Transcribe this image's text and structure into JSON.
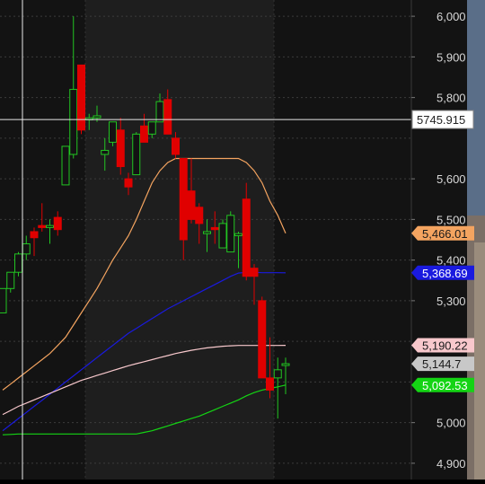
{
  "chart_data": {
    "type": "candlestick",
    "y_axis": {
      "ticks": [
        "6,000",
        "5,900",
        "5,800",
        "5,600",
        "5,500",
        "5,400",
        "5,300",
        "5,000",
        "4,900"
      ],
      "tick_values": [
        6000,
        5900,
        5800,
        5600,
        5500,
        5400,
        5300,
        5000,
        4900
      ],
      "ylim": [
        4860,
        6040
      ],
      "position": "right",
      "grid": true
    },
    "crosshair": {
      "price": 5745.915,
      "label": "5745.915"
    },
    "price_tags": [
      {
        "label": "5,466.01",
        "value": 5466.01,
        "color": "#f4a460"
      },
      {
        "label": "5,368.69",
        "value": 5368.69,
        "color": "#1a1adf"
      },
      {
        "label": "5,190.22",
        "value": 5190.22,
        "color": "#f8c8cc"
      },
      {
        "label": "5,144.7",
        "value": 5144.7,
        "color": "#c8c8c8"
      },
      {
        "label": "5,092.53",
        "value": 5092.53,
        "color": "#14d414"
      }
    ],
    "colors": {
      "up": "#22c522",
      "down": "#e00000",
      "background": "#131313",
      "shaded_band": "#1e1e1e"
    },
    "candles": [
      {
        "o": 5270,
        "h": 5330,
        "l": 5270,
        "c": 5330
      },
      {
        "o": 5330,
        "h": 5370,
        "l": 5320,
        "c": 5370
      },
      {
        "o": 5370,
        "h": 5420,
        "l": 5360,
        "c": 5415
      },
      {
        "o": 5415,
        "h": 5460,
        "l": 5400,
        "c": 5440
      },
      {
        "o": 5470,
        "h": 5480,
        "l": 5410,
        "c": 5455
      },
      {
        "o": 5485,
        "h": 5540,
        "l": 5470,
        "c": 5480
      },
      {
        "o": 5480,
        "h": 5500,
        "l": 5440,
        "c": 5485
      },
      {
        "o": 5505,
        "h": 5520,
        "l": 5460,
        "c": 5475
      },
      {
        "o": 5585,
        "h": 5680,
        "l": 5585,
        "c": 5680
      },
      {
        "o": 5660,
        "h": 6000,
        "l": 5650,
        "c": 5820
      },
      {
        "o": 5880,
        "h": 5880,
        "l": 5710,
        "c": 5720
      },
      {
        "o": 5745,
        "h": 5760,
        "l": 5720,
        "c": 5750
      },
      {
        "o": 5750,
        "h": 5780,
        "l": 5740,
        "c": 5755
      },
      {
        "o": 5660,
        "h": 5700,
        "l": 5620,
        "c": 5670
      },
      {
        "o": 5690,
        "h": 5740,
        "l": 5680,
        "c": 5740
      },
      {
        "o": 5720,
        "h": 5750,
        "l": 5610,
        "c": 5630
      },
      {
        "o": 5600,
        "h": 5615,
        "l": 5560,
        "c": 5580
      },
      {
        "o": 5610,
        "h": 5715,
        "l": 5610,
        "c": 5710
      },
      {
        "o": 5730,
        "h": 5760,
        "l": 5700,
        "c": 5690
      },
      {
        "o": 5710,
        "h": 5740,
        "l": 5700,
        "c": 5740
      },
      {
        "o": 5740,
        "h": 5810,
        "l": 5740,
        "c": 5790
      },
      {
        "o": 5795,
        "h": 5820,
        "l": 5710,
        "c": 5710
      },
      {
        "o": 5700,
        "h": 5715,
        "l": 5650,
        "c": 5660
      },
      {
        "o": 5650,
        "h": 5650,
        "l": 5400,
        "c": 5450
      },
      {
        "o": 5570,
        "h": 5650,
        "l": 5490,
        "c": 5500
      },
      {
        "o": 5530,
        "h": 5540,
        "l": 5440,
        "c": 5490
      },
      {
        "o": 5465,
        "h": 5500,
        "l": 5420,
        "c": 5470
      },
      {
        "o": 5480,
        "h": 5520,
        "l": 5440,
        "c": 5475
      },
      {
        "o": 5430,
        "h": 5500,
        "l": 5430,
        "c": 5490
      },
      {
        "o": 5420,
        "h": 5520,
        "l": 5420,
        "c": 5510
      },
      {
        "o": 5460,
        "h": 5470,
        "l": 5380,
        "c": 5465
      },
      {
        "o": 5550,
        "h": 5590,
        "l": 5350,
        "c": 5360
      },
      {
        "o": 5380,
        "h": 5390,
        "l": 5290,
        "c": 5360
      },
      {
        "o": 5300,
        "h": 5310,
        "l": 5110,
        "c": 5110
      },
      {
        "o": 5110,
        "h": 5210,
        "l": 5060,
        "c": 5080
      },
      {
        "o": 5110,
        "h": 5160,
        "l": 5010,
        "c": 5130
      },
      {
        "o": 5145,
        "h": 5160,
        "l": 5070,
        "c": 5145
      }
    ],
    "moving_averages": [
      {
        "color": "#f4a460",
        "values": [
          5080,
          5095,
          5110,
          5125,
          5140,
          5155,
          5170,
          5190,
          5210,
          5240,
          5270,
          5300,
          5330,
          5365,
          5400,
          5430,
          5460,
          5500,
          5545,
          5590,
          5620,
          5640,
          5650,
          5650,
          5650,
          5650,
          5650,
          5650,
          5650,
          5650,
          5650,
          5640,
          5620,
          5590,
          5545,
          5510,
          5466.01
        ]
      },
      {
        "color": "#1a1adf",
        "values": [
          4980,
          4995,
          5010,
          5025,
          5040,
          5055,
          5070,
          5085,
          5100,
          5115,
          5130,
          5145,
          5160,
          5175,
          5190,
          5205,
          5220,
          5232,
          5244,
          5256,
          5268,
          5280,
          5290,
          5300,
          5310,
          5320,
          5330,
          5340,
          5350,
          5360,
          5368,
          5370,
          5370,
          5369,
          5369,
          5369,
          5368.69
        ]
      },
      {
        "color": "#f8c8cc",
        "values": [
          5020,
          5030,
          5040,
          5048,
          5056,
          5064,
          5072,
          5080,
          5088,
          5096,
          5104,
          5110,
          5116,
          5122,
          5128,
          5134,
          5140,
          5145,
          5150,
          5155,
          5160,
          5165,
          5170,
          5174,
          5178,
          5181,
          5184,
          5186,
          5188,
          5189,
          5190,
          5190,
          5190,
          5190,
          5190,
          5190,
          5190.22
        ]
      },
      {
        "color": "#14d414",
        "values": [
          4970,
          4971,
          4972,
          4972,
          4972,
          4972,
          4972,
          4972,
          4972,
          4972,
          4972,
          4972,
          4972,
          4972,
          4972,
          4972,
          4972,
          4972,
          4976,
          4980,
          4986,
          4992,
          4998,
          5004,
          5010,
          5016,
          5024,
          5032,
          5040,
          5048,
          5056,
          5066,
          5074,
          5080,
          5084,
          5088,
          5092.53
        ]
      }
    ]
  }
}
